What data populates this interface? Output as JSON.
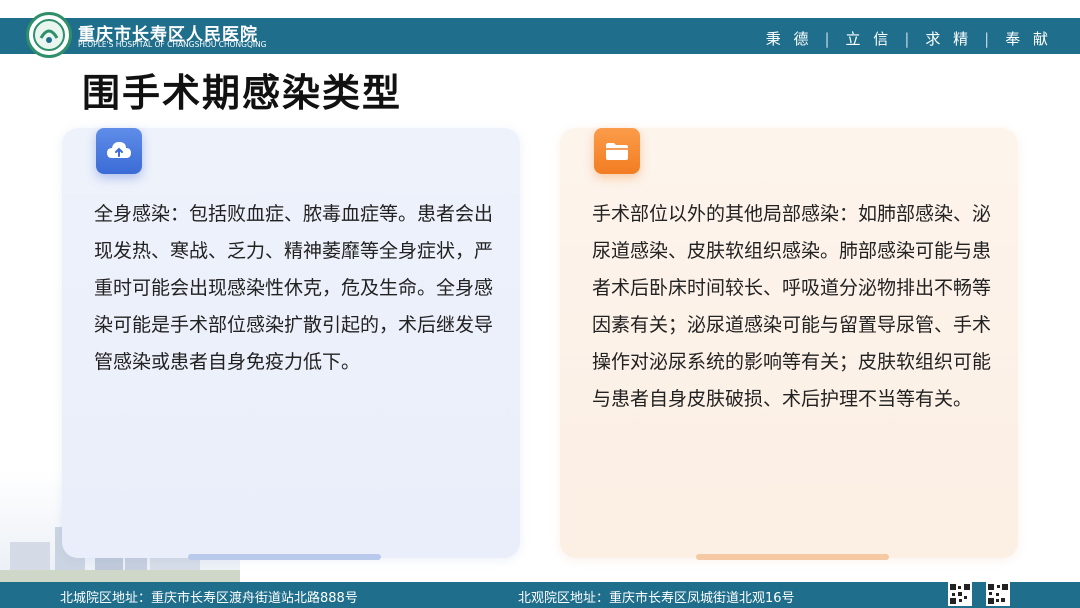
{
  "header": {
    "hospital_name_cn": "重庆市长寿区人民医院",
    "hospital_name_en": "PEOPLE'S HOSPITAL OF CHANGSHOU CHONGQING",
    "motto": [
      "秉 德",
      "立 信",
      "求 精",
      "奉 献"
    ]
  },
  "title": "围手术期感染类型",
  "cards": [
    {
      "icon": "cloud-upload-icon",
      "text": "全身感染：包括败血症、脓毒血症等。患者会出现发热、寒战、乏力、精神萎靡等全身症状，严重时可能会出现感染性休克，危及生命。全身感染可能是手术部位感染扩散引起的，术后继发导管感染或患者自身免疫力低下。"
    },
    {
      "icon": "folder-icon",
      "text": "手术部位以外的其他局部感染：如肺部感染、泌尿道感染、皮肤软组织感染。肺部感染可能与患者术后卧床时间较长、呼吸道分泌物排出不畅等因素有关；泌尿道感染可能与留置导尿管、手术操作对泌尿系统的影响等有关；皮肤软组织可能与患者自身皮肤破损、术后护理不当等有关。"
    }
  ],
  "footer": {
    "address_north": "北城院区地址：重庆市长寿区渡舟街道站北路888号",
    "address_beiguan": "北观院区地址：重庆市长寿区凤城街道北观16号"
  },
  "colors": {
    "brand": "#1f6e8c",
    "card_blue": "#3b6bd6",
    "card_orange": "#f27d22"
  }
}
